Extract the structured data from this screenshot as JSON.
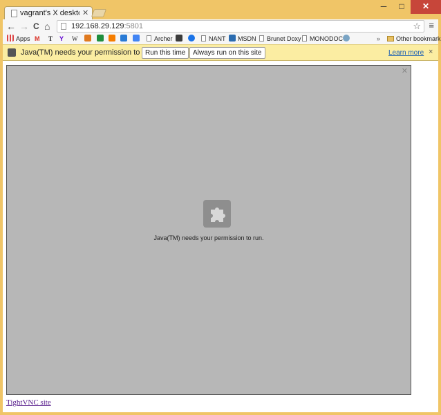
{
  "tabs": [
    {
      "title": "vagrant's X desktop (preci",
      "active": true
    }
  ],
  "window_controls": {
    "minimize": "─",
    "maximize": "□",
    "close": "✕"
  },
  "toolbar": {
    "back": "←",
    "forward": "→",
    "reload": "C",
    "home": "⌂",
    "url_host": "192.168.29.129",
    "url_port": ":5801",
    "star": "☆",
    "menu": "≡"
  },
  "bookmarks": {
    "items": [
      {
        "label": "Apps",
        "icon": "apps-grid-icon",
        "color": "#d44"
      },
      {
        "label": "",
        "icon": "gmail-icon",
        "color": "#d93025"
      },
      {
        "label": "",
        "icon": "nytimes-icon",
        "color": "#222"
      },
      {
        "label": "",
        "icon": "yahoo-icon",
        "color": "#6001d2"
      },
      {
        "label": "",
        "icon": "wikipedia-icon",
        "color": "#333"
      },
      {
        "label": "",
        "icon": "outlook-icon",
        "color": "#e07a1f"
      },
      {
        "label": "",
        "icon": "drive-icon",
        "color": "#1e8e3e"
      },
      {
        "label": "",
        "icon": "blogger-icon",
        "color": "#f57d00"
      },
      {
        "label": "",
        "icon": "nbc-icon",
        "color": "#2a7bd5"
      },
      {
        "label": "",
        "icon": "calendar-icon",
        "color": "#4285f4"
      },
      {
        "label": "Archer",
        "icon": "page-icon"
      },
      {
        "label": "",
        "icon": "colorful-icon",
        "color": "#3b3b3b"
      },
      {
        "label": "",
        "icon": "edge-icon",
        "color": "#1a73e8"
      },
      {
        "label": "NANT",
        "icon": "page-icon"
      },
      {
        "label": "MSDN",
        "icon": "msdn-icon",
        "color": "#2b6cb0"
      },
      {
        "label": "Brunet Doxy",
        "icon": "page-icon"
      },
      {
        "label": "MONODOC",
        "icon": "page-icon"
      },
      {
        "label": "",
        "icon": "mono-icon",
        "color": "#7aa4c4"
      }
    ],
    "overflow": "»",
    "other": "Other bookmarks"
  },
  "infobar": {
    "message": "Java(TM) needs your permission to run.",
    "run_once": "Run this time",
    "always_run": "Always run on this site",
    "learn_more": "Learn more",
    "close": "×"
  },
  "plugin": {
    "message": "Java(TM) needs your permission to run.",
    "close": "✕",
    "icon": "puzzle-piece-icon"
  },
  "footer": {
    "link": "TightVNC site"
  },
  "colors": {
    "frame": "#f0c567",
    "infobar": "#fbeda2",
    "plugin_bg": "#b7b7b7",
    "link_visited": "#551a8b"
  }
}
